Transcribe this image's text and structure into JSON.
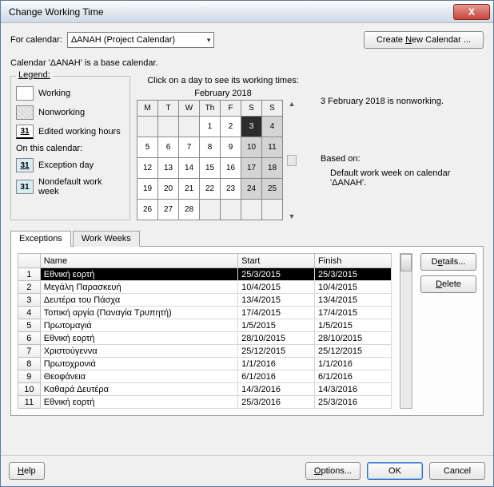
{
  "titlebar": {
    "title": "Change Working Time"
  },
  "close_icon": "X",
  "top": {
    "for_calendar_label": "For calendar:",
    "calendar_name": "ΔΑNAH (Project Calendar)",
    "create_btn_pre": "Create ",
    "create_btn_und": "N",
    "create_btn_post": "ew Calendar ...",
    "note": "Calendar 'ΔANAH' is a base calendar."
  },
  "legend": {
    "title": "Legend:",
    "working": "Working",
    "nonworking": "Nonworking",
    "edited": "Edited working hours",
    "sub": "On this calendar:",
    "exception": "Exception day",
    "ndw": "Nondefault work week",
    "num": "31"
  },
  "calendar": {
    "hint": "Click on a day to see its working times:",
    "month": "February 2018",
    "dows": [
      "M",
      "T",
      "W",
      "Th",
      "F",
      "S",
      "S"
    ],
    "weeks": [
      [
        {
          "v": "",
          "cls": "empty"
        },
        {
          "v": "",
          "cls": "empty"
        },
        {
          "v": "",
          "cls": "empty"
        },
        {
          "v": "1"
        },
        {
          "v": "2"
        },
        {
          "v": "3",
          "cls": "selected"
        },
        {
          "v": "4",
          "cls": "nw"
        }
      ],
      [
        {
          "v": "5"
        },
        {
          "v": "6"
        },
        {
          "v": "7"
        },
        {
          "v": "8"
        },
        {
          "v": "9"
        },
        {
          "v": "10",
          "cls": "nw"
        },
        {
          "v": "11",
          "cls": "nw"
        }
      ],
      [
        {
          "v": "12"
        },
        {
          "v": "13"
        },
        {
          "v": "14"
        },
        {
          "v": "15"
        },
        {
          "v": "16"
        },
        {
          "v": "17",
          "cls": "nw"
        },
        {
          "v": "18",
          "cls": "nw"
        }
      ],
      [
        {
          "v": "19"
        },
        {
          "v": "20"
        },
        {
          "v": "21"
        },
        {
          "v": "22"
        },
        {
          "v": "23"
        },
        {
          "v": "24",
          "cls": "nw"
        },
        {
          "v": "25",
          "cls": "nw"
        }
      ],
      [
        {
          "v": "26"
        },
        {
          "v": "27"
        },
        {
          "v": "28"
        },
        {
          "v": "",
          "cls": "empty"
        },
        {
          "v": "",
          "cls": "empty"
        },
        {
          "v": "",
          "cls": "empty"
        },
        {
          "v": "",
          "cls": "empty"
        }
      ]
    ],
    "nav_up": "▲",
    "nav_down": "▼"
  },
  "info": {
    "line1": "3 February 2018 is nonworking.",
    "based_label": "Based on:",
    "based_text": "Default work week on calendar 'ΔANAH'."
  },
  "tabs": {
    "exceptions": "Exceptions",
    "workweeks": "Work Weeks"
  },
  "grid": {
    "headers": {
      "name": "Name",
      "start": "Start",
      "finish": "Finish"
    },
    "rows": [
      {
        "n": "1",
        "name": "Εθνική εορτή",
        "start": "25/3/2015",
        "finish": "25/3/2015",
        "sel": true
      },
      {
        "n": "2",
        "name": "Μεγάλη Παρασκευή",
        "start": "10/4/2015",
        "finish": "10/4/2015"
      },
      {
        "n": "3",
        "name": "Δευτέρα του Πάσχα",
        "start": "13/4/2015",
        "finish": "13/4/2015"
      },
      {
        "n": "4",
        "name": "Τοπική αργία (Παναγία Τρυπητή)",
        "start": "17/4/2015",
        "finish": "17/4/2015"
      },
      {
        "n": "5",
        "name": "Πρωτομαγιά",
        "start": "1/5/2015",
        "finish": "1/5/2015"
      },
      {
        "n": "6",
        "name": "Εθνική εορτή",
        "start": "28/10/2015",
        "finish": "28/10/2015"
      },
      {
        "n": "7",
        "name": "Χριστούγεννα",
        "start": "25/12/2015",
        "finish": "25/12/2015"
      },
      {
        "n": "8",
        "name": "Πρωτοχρονιά",
        "start": "1/1/2016",
        "finish": "1/1/2016"
      },
      {
        "n": "9",
        "name": "Θεοφάνεια",
        "start": "6/1/2016",
        "finish": "6/1/2016"
      },
      {
        "n": "10",
        "name": "Καθαρά Δευτέρα",
        "start": "14/3/2016",
        "finish": "14/3/2016"
      },
      {
        "n": "11",
        "name": "Εθνική εορτή",
        "start": "25/3/2016",
        "finish": "25/3/2016"
      }
    ]
  },
  "side": {
    "details_pre": "D",
    "details_u": "e",
    "details_post": "tails...",
    "delete": "Delete"
  },
  "bottom": {
    "help_u": "H",
    "help_post": "elp",
    "options_u": "O",
    "options_post": "ptions...",
    "ok": "OK",
    "cancel": "Cancel"
  }
}
